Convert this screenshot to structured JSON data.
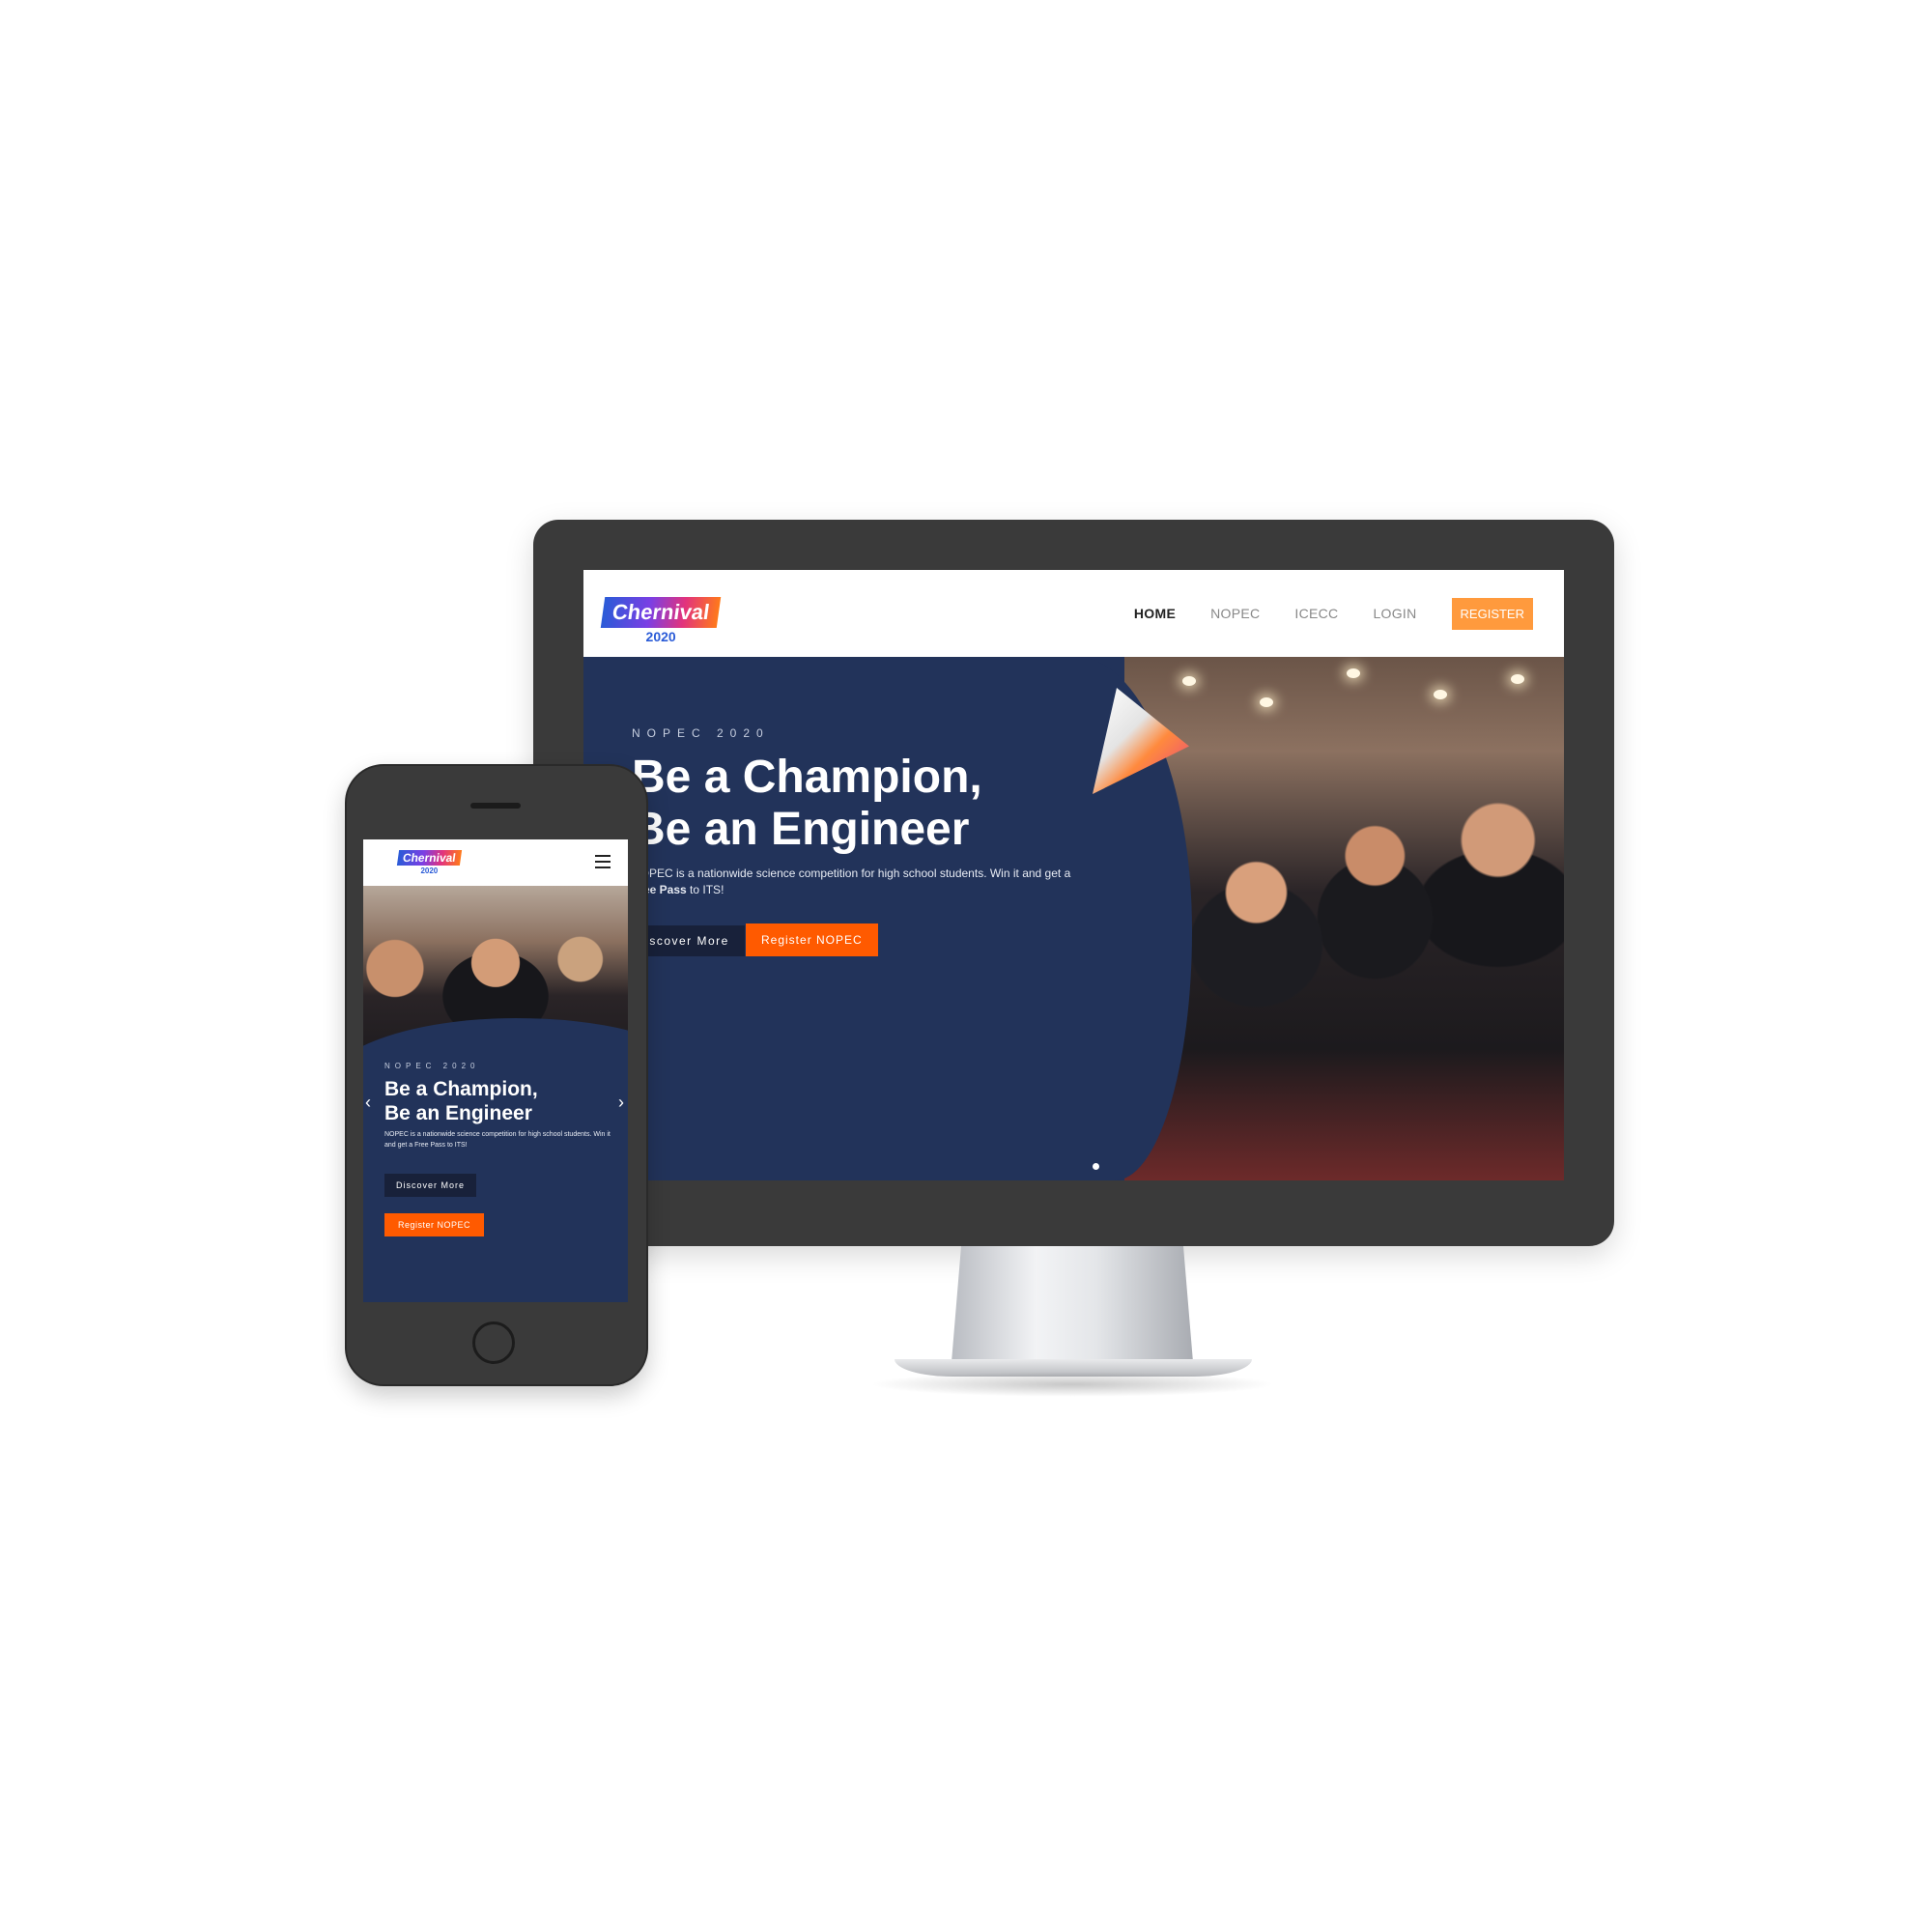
{
  "brand": {
    "name": "Chernival",
    "year": "2020"
  },
  "desktop": {
    "nav": {
      "items": [
        "HOME",
        "NOPEC",
        "ICECC",
        "LOGIN"
      ],
      "register": "REGISTER"
    },
    "hero": {
      "eyebrow": "NOPEC 2020",
      "title_line1": "Be a Champion,",
      "title_line2": "Be an Engineer",
      "description_start": "NOPEC is a nationwide science competition for high school students. Win it and get a ",
      "description_bold": "Free Pass",
      "description_end": " to ITS!",
      "discover_button": "Discover More",
      "register_button": "Register NOPEC"
    }
  },
  "mobile": {
    "hero": {
      "eyebrow": "NOPEC 2020",
      "title_line1": "Be a Champion,",
      "title_line2": "Be an Engineer",
      "description": "NOPEC is a nationwide science competition for high school students. Win it and get a Free Pass to ITS!",
      "discover_button": "Discover More",
      "register_button": "Register NOPEC"
    }
  },
  "icons": [
    "menu-icon",
    "chevron-left-icon",
    "chevron-right-icon",
    "triangle-logo-icon"
  ],
  "colors": {
    "navy": "#22335a",
    "orange": "#ff5a00",
    "register_nav": "#ff9a3d",
    "device": "#3a3a3a"
  }
}
